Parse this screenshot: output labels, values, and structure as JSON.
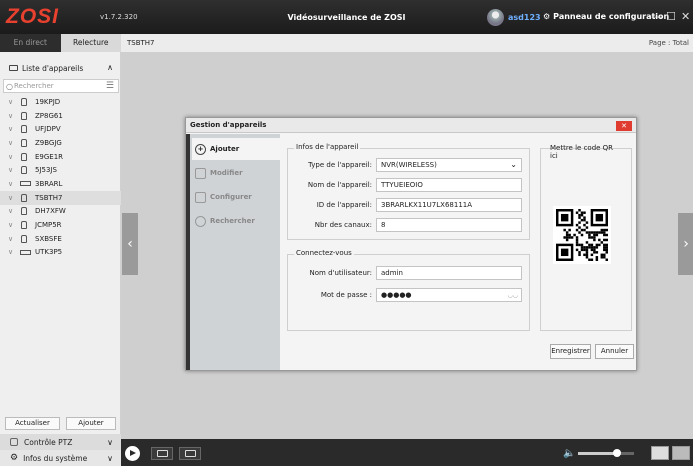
{
  "app": {
    "logo_text": "ZOSI",
    "version": "v1.7.2.320",
    "title": "Vidéosurveillance de ZOSI",
    "user": "asd123",
    "control_panel": "Panneau de configuration",
    "minimize": "—",
    "maximize": "☐",
    "close": "✕"
  },
  "tabs": {
    "live": "En direct",
    "playback": "Relecture"
  },
  "viewport": {
    "device_name": "TSBTH7",
    "page_label": "Page : Total"
  },
  "sidebar": {
    "device_list_label": "Liste d'appareils",
    "search_placeholder": "Rechercher",
    "devices": [
      {
        "name": "19KPJD",
        "type": "camera"
      },
      {
        "name": "ZP8G61",
        "type": "camera"
      },
      {
        "name": "UFJDPV",
        "type": "camera"
      },
      {
        "name": "Z9BGJG",
        "type": "camera"
      },
      {
        "name": "E9GE1R",
        "type": "camera"
      },
      {
        "name": "5J53JS",
        "type": "camera"
      },
      {
        "name": "3BRARL",
        "type": "nvr"
      },
      {
        "name": "TSBTH7",
        "type": "camera",
        "selected": true
      },
      {
        "name": "DH7XFW",
        "type": "camera"
      },
      {
        "name": "JCMP5R",
        "type": "camera"
      },
      {
        "name": "SXBSFE",
        "type": "camera"
      },
      {
        "name": "UTK3P5",
        "type": "nvr"
      }
    ],
    "refresh": "Actualiser",
    "add": "Ajouter",
    "ptz": "Contrôle PTZ",
    "sysinfo": "Infos du système"
  },
  "dialog": {
    "title": "Gestion d'appareils",
    "close": "✕",
    "nav": {
      "add": "Ajouter",
      "edit": "Modifier",
      "configure": "Configurer",
      "search": "Rechercher"
    },
    "device_info_legend": "Infos de l'appareil",
    "type_label": "Type de l'appareil:",
    "type_value": "NVR(WIRELESS)",
    "name_label": "Nom de l'appareil:",
    "name_value": "TTYUEIEOIO",
    "id_label": "ID de l'appareil:",
    "id_value": "3BRARLKX11U7LX68111A",
    "channels_label": "Nbr des canaux:",
    "channels_value": "8",
    "login_legend": "Connectez-vous",
    "username_label": "Nom d'utilisateur:",
    "username_value": "admin",
    "password_label": "Mot de passe :",
    "password_value": "●●●●●",
    "qr_label": "Mettre le code QR ici",
    "save": "Enregistrer",
    "cancel": "Annuler"
  },
  "volume_level": 0.7
}
